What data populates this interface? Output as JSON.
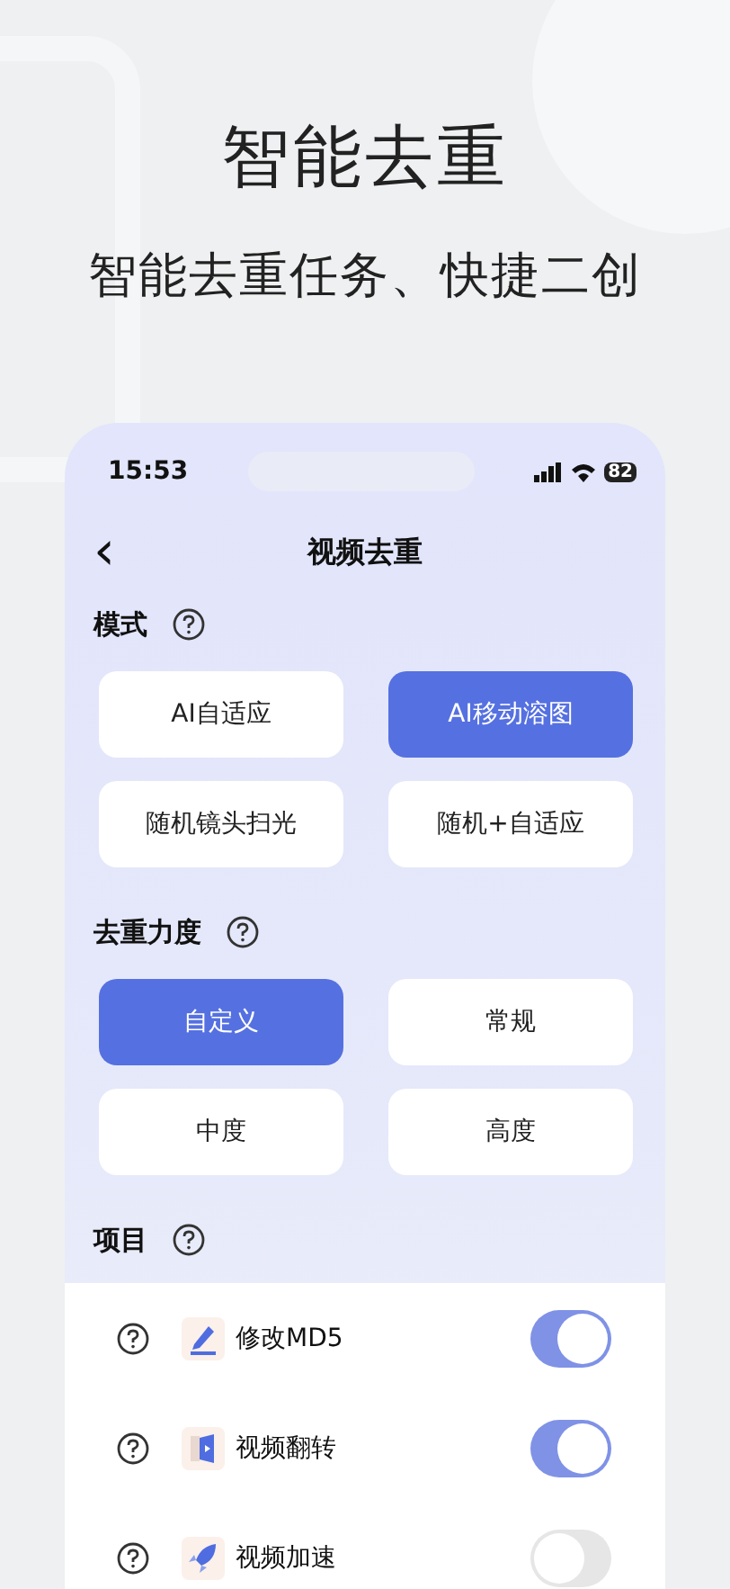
{
  "headline": "智能去重",
  "subtitle": "智能去重任务、快捷二创",
  "status_bar": {
    "time": "15:53",
    "battery": "82"
  },
  "nav": {
    "back": "‹",
    "title": "视频去重"
  },
  "sections": [
    {
      "kind": "options",
      "label": "模式",
      "options": [
        {
          "label": "AI自适应",
          "selected": false
        },
        {
          "label": "AI移动溶图",
          "selected": true
        },
        {
          "label": "随机镜头扫光",
          "selected": false
        },
        {
          "label": "随机+自适应",
          "selected": false
        }
      ]
    },
    {
      "kind": "options",
      "label": "去重力度",
      "options": [
        {
          "label": "自定义",
          "selected": true
        },
        {
          "label": "常规",
          "selected": false
        },
        {
          "label": "中度",
          "selected": false
        },
        {
          "label": "高度",
          "selected": false
        }
      ]
    },
    {
      "kind": "toggles",
      "label": "项目",
      "items": [
        {
          "label": "修改MD5",
          "on": true
        },
        {
          "label": "视频翻转",
          "on": true
        },
        {
          "label": "视频加速",
          "on": false
        }
      ]
    }
  ]
}
